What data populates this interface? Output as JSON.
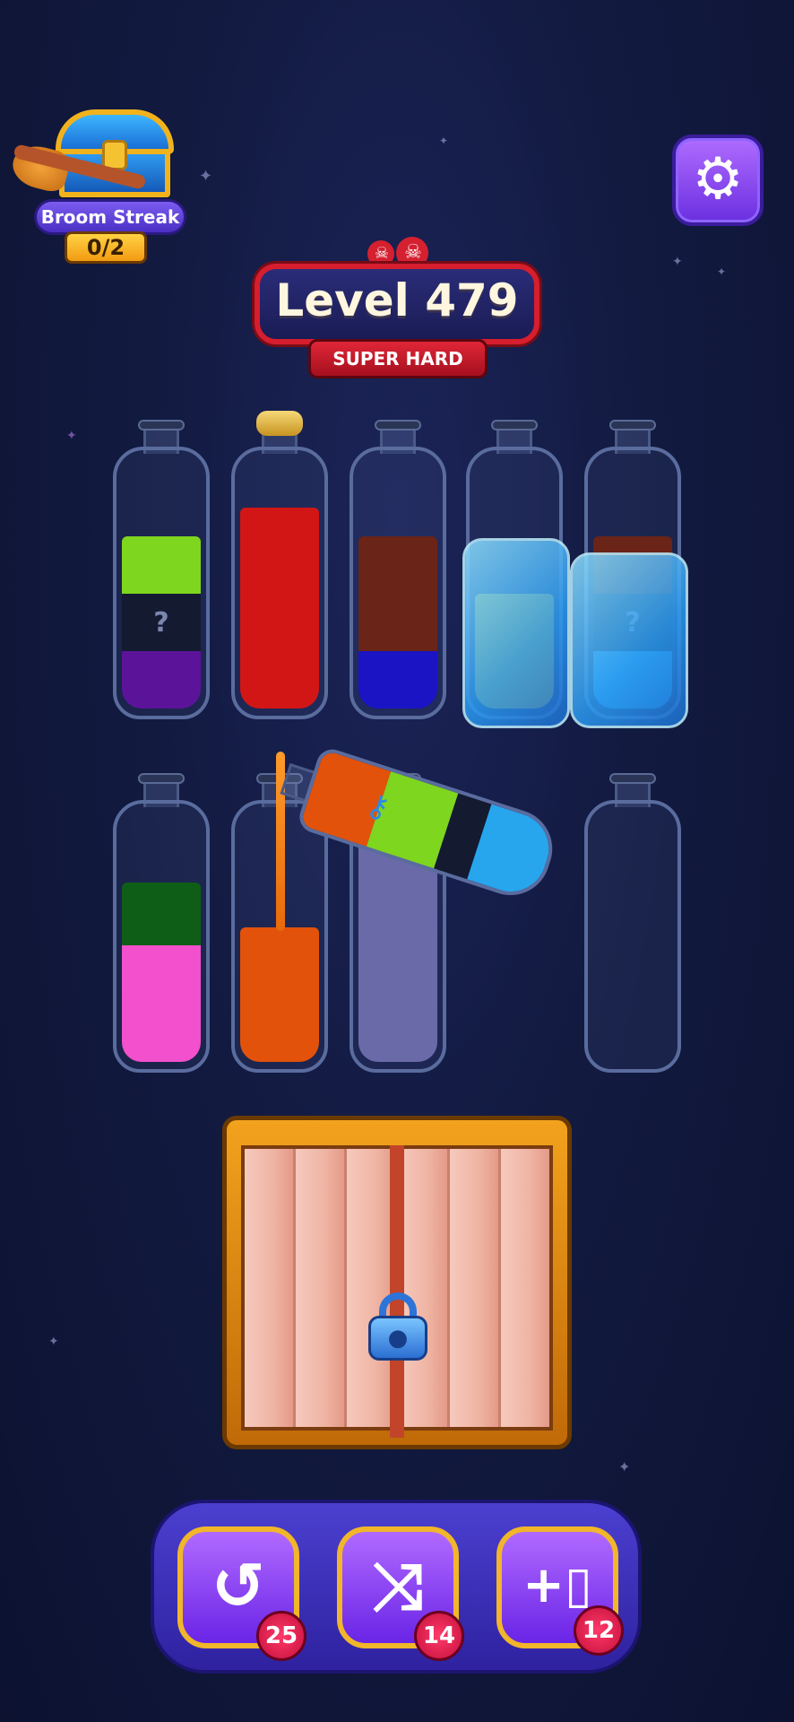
{
  "broom_streak": {
    "label": "Broom Streak",
    "count": "0/2"
  },
  "settings": {
    "icon": "gear-icon"
  },
  "level": {
    "title": "Level 479",
    "difficulty": "SUPER HARD",
    "difficulty_icon": "skull-icon"
  },
  "colors": {
    "lime": "#7ed61e",
    "hidden": "#141a30",
    "purple": "#5b1499",
    "red": "#d21616",
    "brown": "#6a2418",
    "blue": "#1a14c4",
    "yellow": "#f2c40c",
    "cyan": "#27a6ee",
    "green": "#0f5e18",
    "pink": "#f250cc",
    "orange": "#e2520a",
    "lavender": "#6a6aa8"
  },
  "bottles": [
    {
      "id": "b1",
      "layers": [
        {
          "color": "purple",
          "unknown": false
        },
        {
          "color": "hidden",
          "unknown": true
        },
        {
          "color": "lime",
          "unknown": false
        }
      ],
      "mark": "?"
    },
    {
      "id": "b2",
      "layers": [
        {
          "color": "red"
        },
        {
          "color": "red"
        },
        {
          "color": "red"
        },
        {
          "color": "red"
        }
      ],
      "corked": true
    },
    {
      "id": "b3",
      "layers": [
        {
          "color": "blue"
        },
        {
          "color": "brown"
        },
        {
          "color": "brown"
        }
      ]
    },
    {
      "id": "b4",
      "layers": [
        {
          "color": "yellow"
        },
        {
          "color": "yellow"
        }
      ],
      "frozen": true
    },
    {
      "id": "b5",
      "layers": [
        {
          "color": "cyan"
        },
        {
          "color": "hidden",
          "unknown": true
        },
        {
          "color": "brown"
        }
      ],
      "frozen": true,
      "mark": "?"
    },
    {
      "id": "b6",
      "layers": [
        {
          "color": "pink"
        },
        {
          "color": "green"
        }
      ]
    },
    {
      "id": "b7",
      "layers": [
        {
          "color": "orange"
        }
      ]
    },
    {
      "id": "b8",
      "layers": [
        {
          "color": "lavender"
        }
      ]
    },
    {
      "id": "b9",
      "layers": []
    }
  ],
  "tilted_bottle": {
    "layers": [
      "orange",
      "lime",
      "hidden",
      "cyan"
    ],
    "key_icon": "key-icon"
  },
  "lock_box": {
    "icon": "padlock-icon"
  },
  "toolbar": {
    "undo": {
      "icon": "undo-icon",
      "count": "25"
    },
    "shuffle": {
      "icon": "shuffle-icon",
      "count": "14"
    },
    "add_bottle": {
      "icon": "add-bottle-icon",
      "count": "12"
    }
  }
}
